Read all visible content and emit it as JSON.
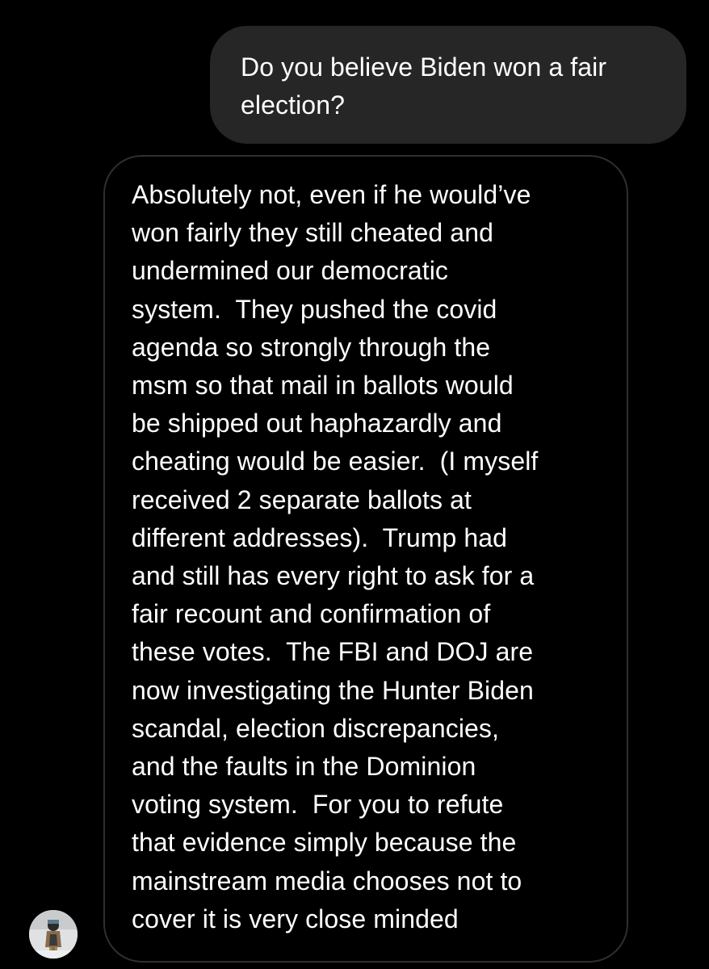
{
  "thread": {
    "sent_message": {
      "text": "Do you believe Biden won a fair election?",
      "lines": [
        "Do you believe Biden won a fair",
        "election?"
      ]
    },
    "received_message": {
      "lines": [
        "Absolutely not, even if he would’ve",
        "won fairly they still cheated and",
        "undermined our democratic",
        "system.  They pushed the covid",
        "agenda so strongly through the",
        "msm so that mail in ballots would",
        "be shipped out haphazardly and",
        "cheating would be easier.  (I myself",
        "received 2 separate ballots at",
        "different addresses).  Trump had",
        "and still has every right to ask for a",
        "fair recount and confirmation of",
        "these votes.  The FBI and DOJ are",
        "now investigating the Hunter Biden",
        "scandal, election discrepancies,",
        "and the faults in the Dominion",
        "voting system.  For you to refute",
        "that evidence simply because the",
        "mainstream media chooses not to",
        "cover it is very close minded"
      ]
    },
    "sender_avatar": {
      "icon": "avatar-photo-icon"
    }
  },
  "colors": {
    "background": "#000000",
    "sent_bubble": "#262626",
    "received_border": "#2f2f2f",
    "text": "#ffffff"
  }
}
